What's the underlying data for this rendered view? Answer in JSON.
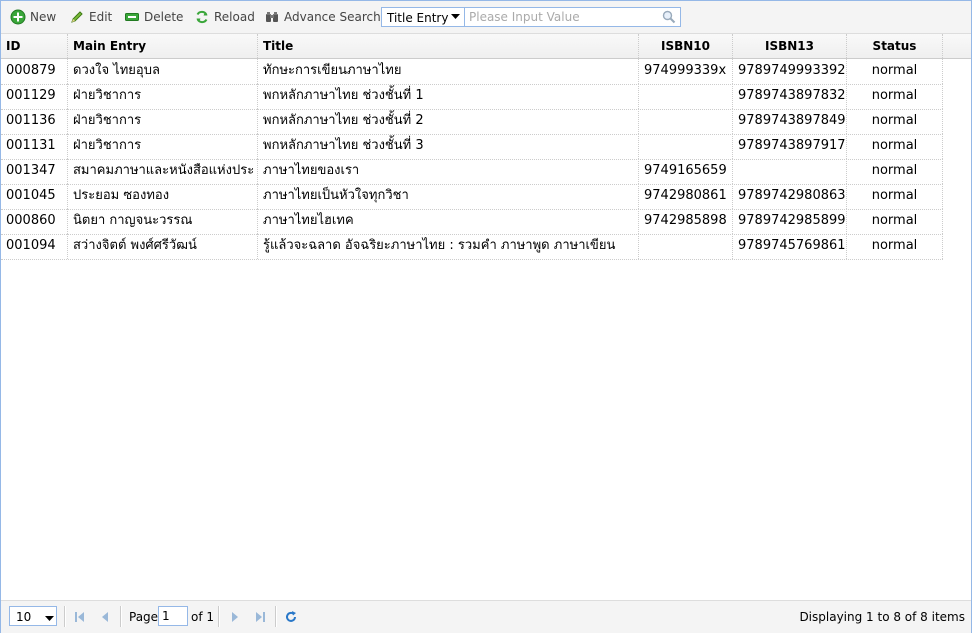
{
  "toolbar": {
    "new_label": "New",
    "edit_label": "Edit",
    "delete_label": "Delete",
    "reload_label": "Reload",
    "advance_search_label": "Advance Search",
    "search_field_selected": "Title Entry",
    "search_placeholder": "Please Input Value"
  },
  "table": {
    "columns": [
      "ID",
      "Main Entry",
      "Title",
      "ISBN10",
      "ISBN13",
      "Status"
    ],
    "rows": [
      [
        "000879",
        "ดวงใจ ไทยอุบล",
        "ทักษะการเขียนภาษาไทย",
        "974999339x",
        "9789749993392",
        "normal"
      ],
      [
        "001129",
        "ฝ่ายวิชาการ",
        "พกหลักภาษาไทย ช่วงชั้นที่ 1",
        "",
        "9789743897832",
        "normal"
      ],
      [
        "001136",
        "ฝ่ายวิชาการ",
        "พกหลักภาษาไทย ช่วงชั้นที่ 2",
        "",
        "9789743897849",
        "normal"
      ],
      [
        "001131",
        "ฝ่ายวิชาการ",
        "พกหลักภาษาไทย ช่วงชั้นที่ 3",
        "",
        "9789743897917",
        "normal"
      ],
      [
        "001347",
        "สมาคมภาษาและหนังสือแห่งประ",
        "ภาษาไทยของเรา",
        "9749165659",
        "",
        "normal"
      ],
      [
        "001045",
        "ประยอม ซองทอง",
        "ภาษาไทยเป็นหัวใจทุกวิชา",
        "9742980861",
        "9789742980863",
        "normal"
      ],
      [
        "000860",
        "นิตยา กาญจนะวรรณ",
        "ภาษาไทยไฮเทค",
        "9742985898",
        "9789742985899",
        "normal"
      ],
      [
        "001094",
        "สว่างจิตต์ พงศ์ศรีวัฒน์",
        "รู้แล้วจะฉลาด อัจฉริยะภาษาไทย : รวมคำ ภาษาพูด ภาษาเขียน",
        "",
        "9789745769861",
        "normal"
      ]
    ]
  },
  "pager": {
    "page_size": "10",
    "page_label": "Page",
    "current_page": "1",
    "of_label": "of 1",
    "display_info": "Displaying 1 to 8 of 8 items"
  },
  "colors": {
    "border": "#95b8e7",
    "toolbar_bg": "#f4f4f4",
    "icon_blue": "#4a90d9",
    "icon_green": "#2e9e2e"
  }
}
